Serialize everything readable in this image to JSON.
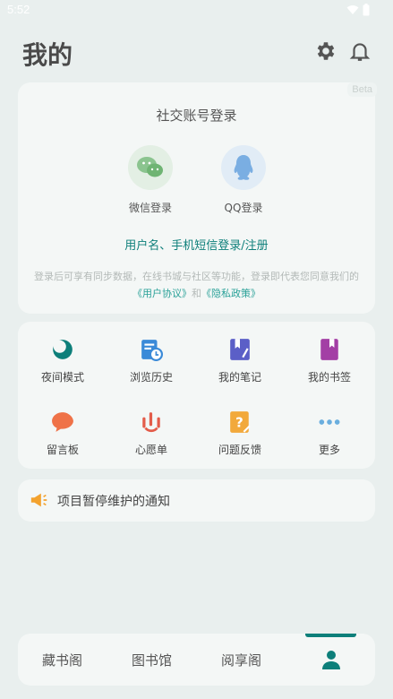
{
  "status": {
    "time": "5:52"
  },
  "header": {
    "title": "我的"
  },
  "login": {
    "beta": "Beta",
    "title": "社交账号登录",
    "wechat_label": "微信登录",
    "qq_label": "QQ登录",
    "user_login": "用户名、手机短信登录/注册",
    "notice_prefix": "登录后可享有同步数据，在线书城与社区等功能，登录即代表您同意我们的",
    "user_agreement": "《用户协议》",
    "and": "和",
    "privacy_policy": "《隐私政策》"
  },
  "features": [
    {
      "label": "夜间模式",
      "icon": "moon-icon",
      "color": "#0d7f7a"
    },
    {
      "label": "浏览历史",
      "icon": "history-icon",
      "color": "#3a8ad8"
    },
    {
      "label": "我的笔记",
      "icon": "notes-icon",
      "color": "#5b5fc7"
    },
    {
      "label": "我的书签",
      "icon": "bookmark-icon",
      "color": "#a33fa5"
    },
    {
      "label": "留言板",
      "icon": "message-board-icon",
      "color": "#ef7248"
    },
    {
      "label": "心愿单",
      "icon": "wishlist-icon",
      "color": "#e35c4a"
    },
    {
      "label": "问题反馈",
      "icon": "feedback-icon",
      "color": "#f2a93b"
    },
    {
      "label": "更多",
      "icon": "more-icon",
      "color": "#6aaede"
    }
  ],
  "announcement": {
    "text": "项目暂停维护的通知",
    "icon": "megaphone-icon",
    "color": "#f3a22e"
  },
  "tabs": [
    {
      "label": "藏书阁"
    },
    {
      "label": "图书馆"
    },
    {
      "label": "阅享阁"
    },
    {
      "label": "",
      "icon": "person-icon",
      "active": true
    }
  ],
  "colors": {
    "accent": "#0d7f7a",
    "background": "#e9efee",
    "card": "#f4f7f6"
  }
}
